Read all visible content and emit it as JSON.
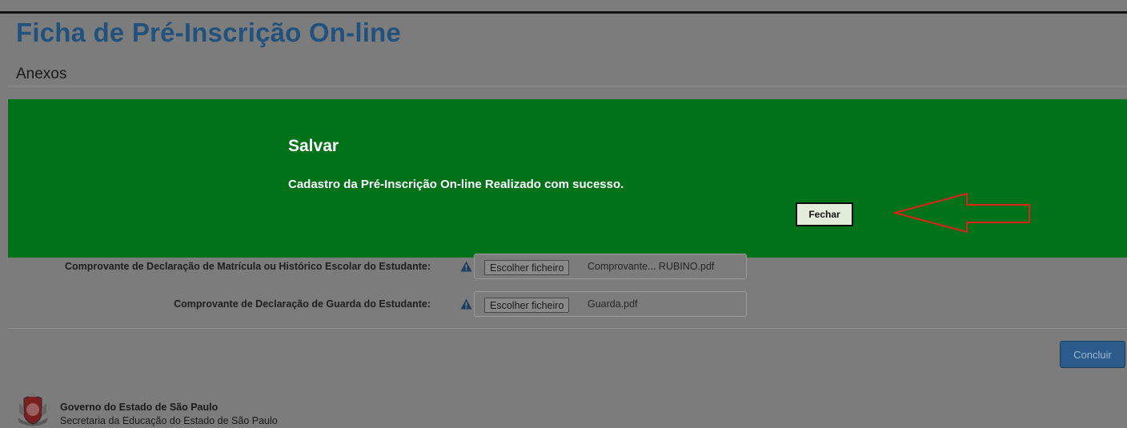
{
  "page": {
    "title": "Ficha de Pré-Inscrição On-line",
    "section": "Anexos"
  },
  "modal": {
    "title": "Salvar",
    "message": "Cadastro da Pré-Inscrição On-line Realizado com sucesso.",
    "close_label": "Fechar",
    "background_color": "#00731a"
  },
  "fields": [
    {
      "label": "Comprovante de Declaração de Matrícula ou Histórico Escolar do Estudante:",
      "button_label": "Escolher ficheiro",
      "file_name": "Comprovante... RUBINO.pdf"
    },
    {
      "label": "Comprovante de Declaração de Guarda do Estudante:",
      "button_label": "Escolher ficheiro",
      "file_name": "Guarda.pdf"
    }
  ],
  "actions": {
    "submit_label": "Concluir"
  },
  "footer": {
    "government": "Governo do Estado de São Paulo",
    "department": "Secretaria da Educação do Estado de São Paulo"
  },
  "icons": {
    "field_warning": "warning-triangle-icon",
    "annotation": "red-arrow-left-icon",
    "footer_logo": "sp-coat-of-arms-icon"
  },
  "colors": {
    "overlay_gray": "#7c7c7c",
    "title_blue": "#21527d",
    "annotation_red": "#e0201a"
  }
}
